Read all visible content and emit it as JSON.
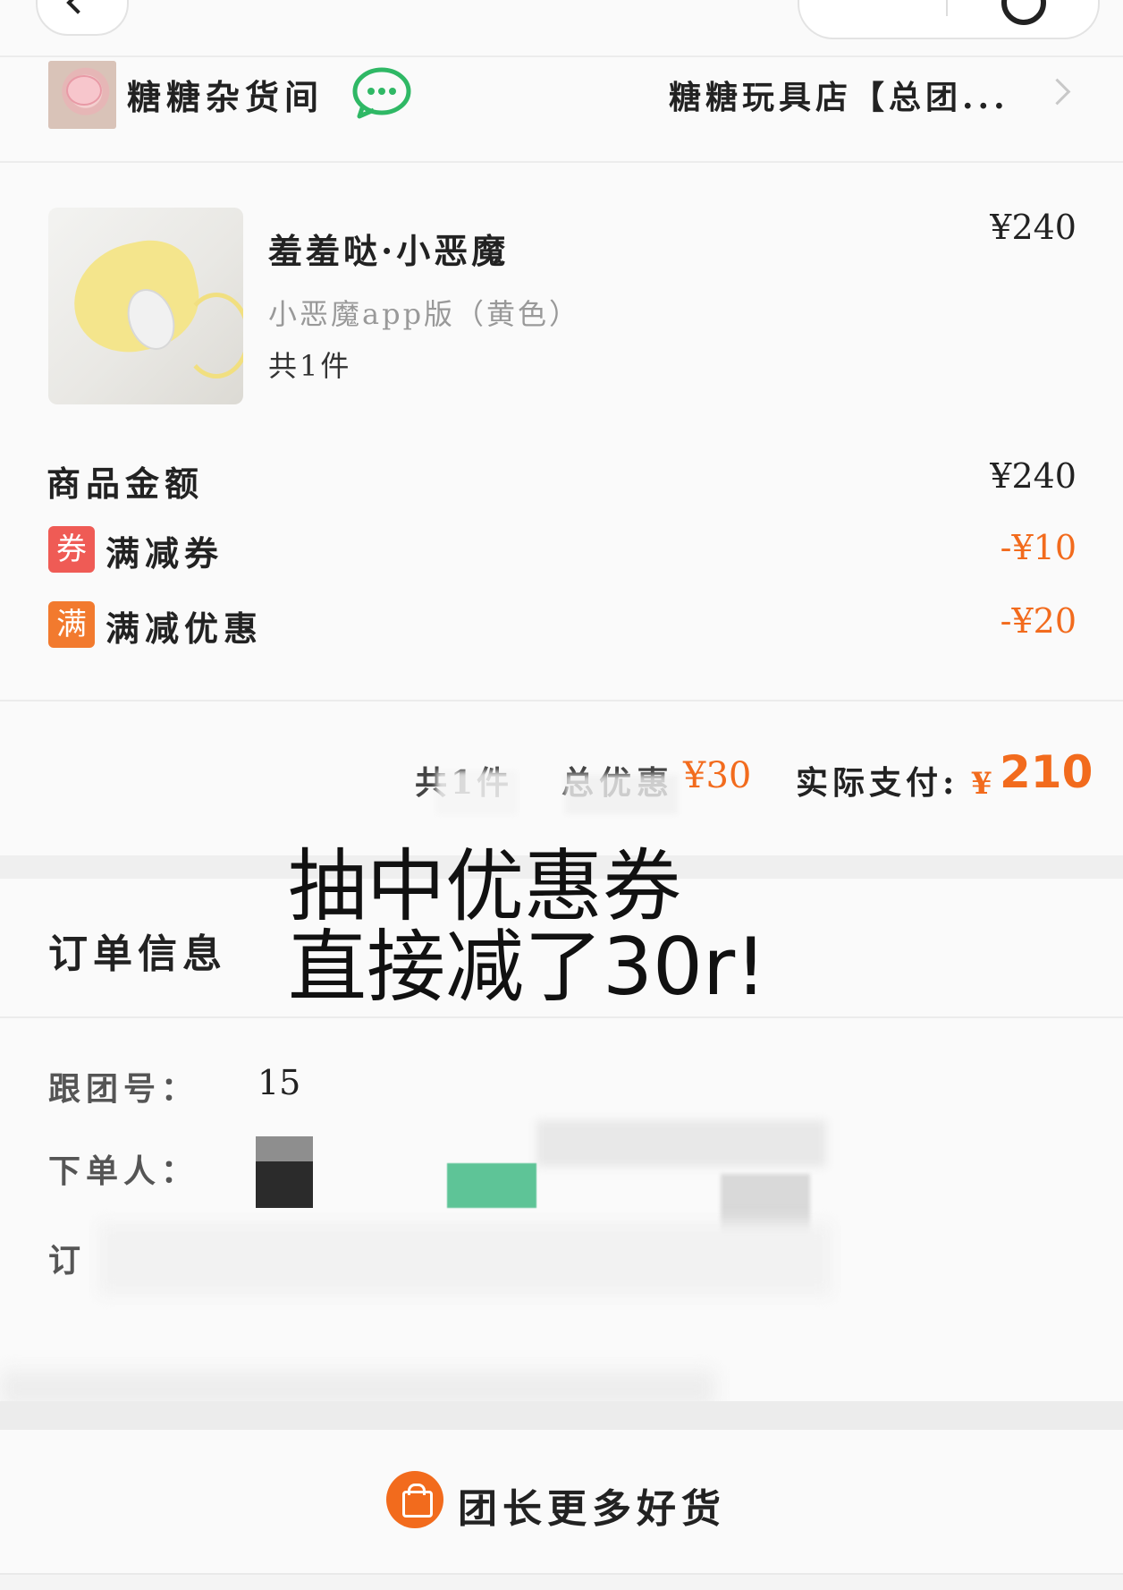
{
  "store": {
    "name": "糖糖杂货间",
    "group_name": "糖糖玩具店【总团..."
  },
  "product": {
    "title": "羞羞哒·小恶魔",
    "spec": "小恶魔app版（黄色）",
    "qty": "共1件",
    "price": "¥240"
  },
  "pricing": {
    "subtotal_label": "商品金额",
    "subtotal": "¥240",
    "coupon_badge": "券",
    "coupon_label": "满减券",
    "coupon_amount": "-¥10",
    "full_badge": "满",
    "full_label": "满减优惠",
    "full_amount": "-¥20"
  },
  "summary": {
    "items": "共1件",
    "saved_label": "总优惠",
    "saved": "¥30",
    "paid_label": "实际支付:",
    "paid_currency": "¥",
    "paid": "210"
  },
  "order_info": {
    "title": "订单信息",
    "group_no_label": "跟团号：",
    "group_no": "15",
    "buyer_label": "下单人：",
    "order_label": "订"
  },
  "overlay_caption": {
    "line1": "抽中优惠券",
    "line2": "直接减了30r!"
  },
  "footer": {
    "label": "团长更多好货"
  },
  "colors": {
    "accent": "#f26b1d",
    "coupon_red": "#ef5b55",
    "chat_green": "#2fb865"
  }
}
